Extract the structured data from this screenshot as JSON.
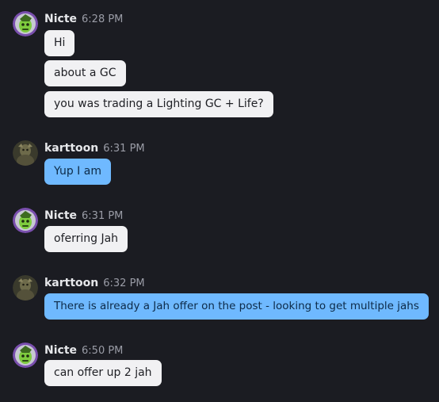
{
  "messages": [
    {
      "author": "Nicte",
      "time": "6:28 PM",
      "avatar": "nicte-avatar",
      "bubbles": [
        "Hi",
        "about a GC",
        "you was trading a Lighting GC + Life?"
      ]
    },
    {
      "author": "karttoon",
      "time": "6:31 PM",
      "avatar": "karttoon-avatar",
      "bubbles": [
        "Yup I am"
      ]
    },
    {
      "author": "Nicte",
      "time": "6:31 PM",
      "avatar": "nicte-avatar",
      "bubbles": [
        "oferring Jah"
      ]
    },
    {
      "author": "karttoon",
      "time": "6:32 PM",
      "avatar": "karttoon-avatar",
      "bubbles": [
        "There is already a Jah offer on the post - looking to get multiple jahs"
      ]
    },
    {
      "author": "Nicte",
      "time": "6:50 PM",
      "avatar": "nicte-avatar",
      "bubbles": [
        "can offer up 2 jah"
      ]
    }
  ],
  "colors": {
    "background": "#1b1c22",
    "incoming_bubble": "#f1f1f3",
    "outgoing_bubble": "#6fb9ff"
  }
}
